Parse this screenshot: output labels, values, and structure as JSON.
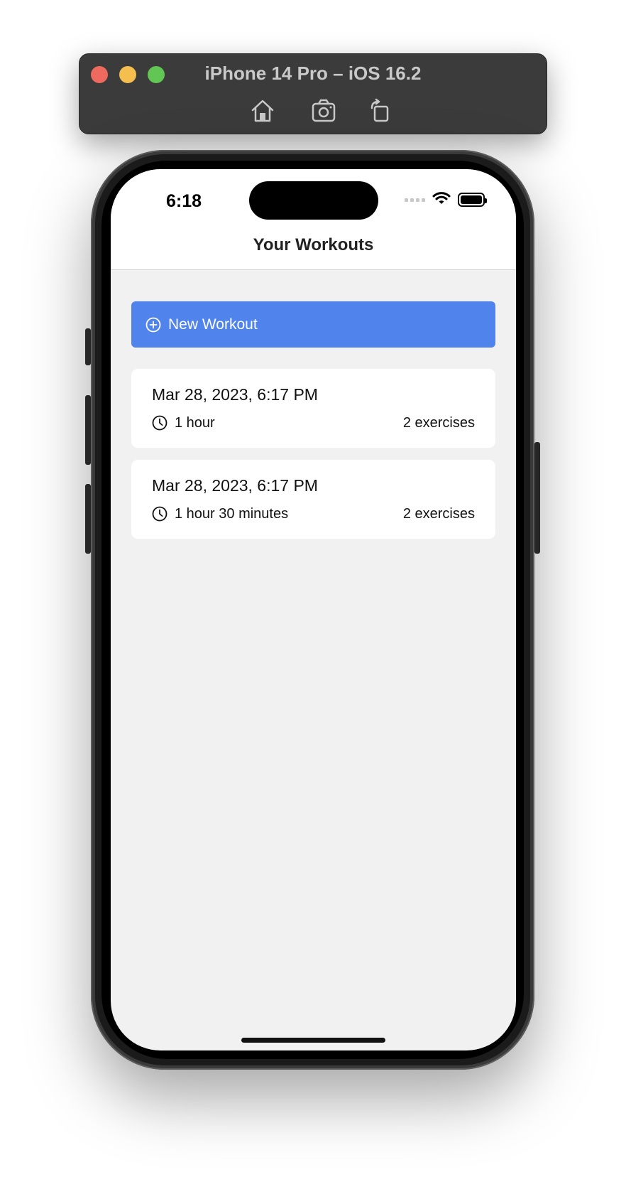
{
  "simulator": {
    "title": "iPhone 14 Pro – iOS 16.2",
    "toolbar_icons": [
      "home-icon",
      "screenshot-icon",
      "rotate-icon"
    ]
  },
  "status_bar": {
    "time": "6:18",
    "icons": [
      "cellular-icon",
      "wifi-icon",
      "battery-icon"
    ]
  },
  "nav": {
    "title": "Your Workouts"
  },
  "new_workout_button": {
    "label": "New Workout",
    "icon": "plus-circle-icon",
    "color": "#5083ec"
  },
  "workouts": [
    {
      "date": "Mar 28, 2023, 6:17 PM",
      "duration": "1 hour",
      "exercises": "2 exercises"
    },
    {
      "date": "Mar 28, 2023, 6:17 PM",
      "duration": "1 hour 30 minutes",
      "exercises": "2 exercises"
    }
  ]
}
